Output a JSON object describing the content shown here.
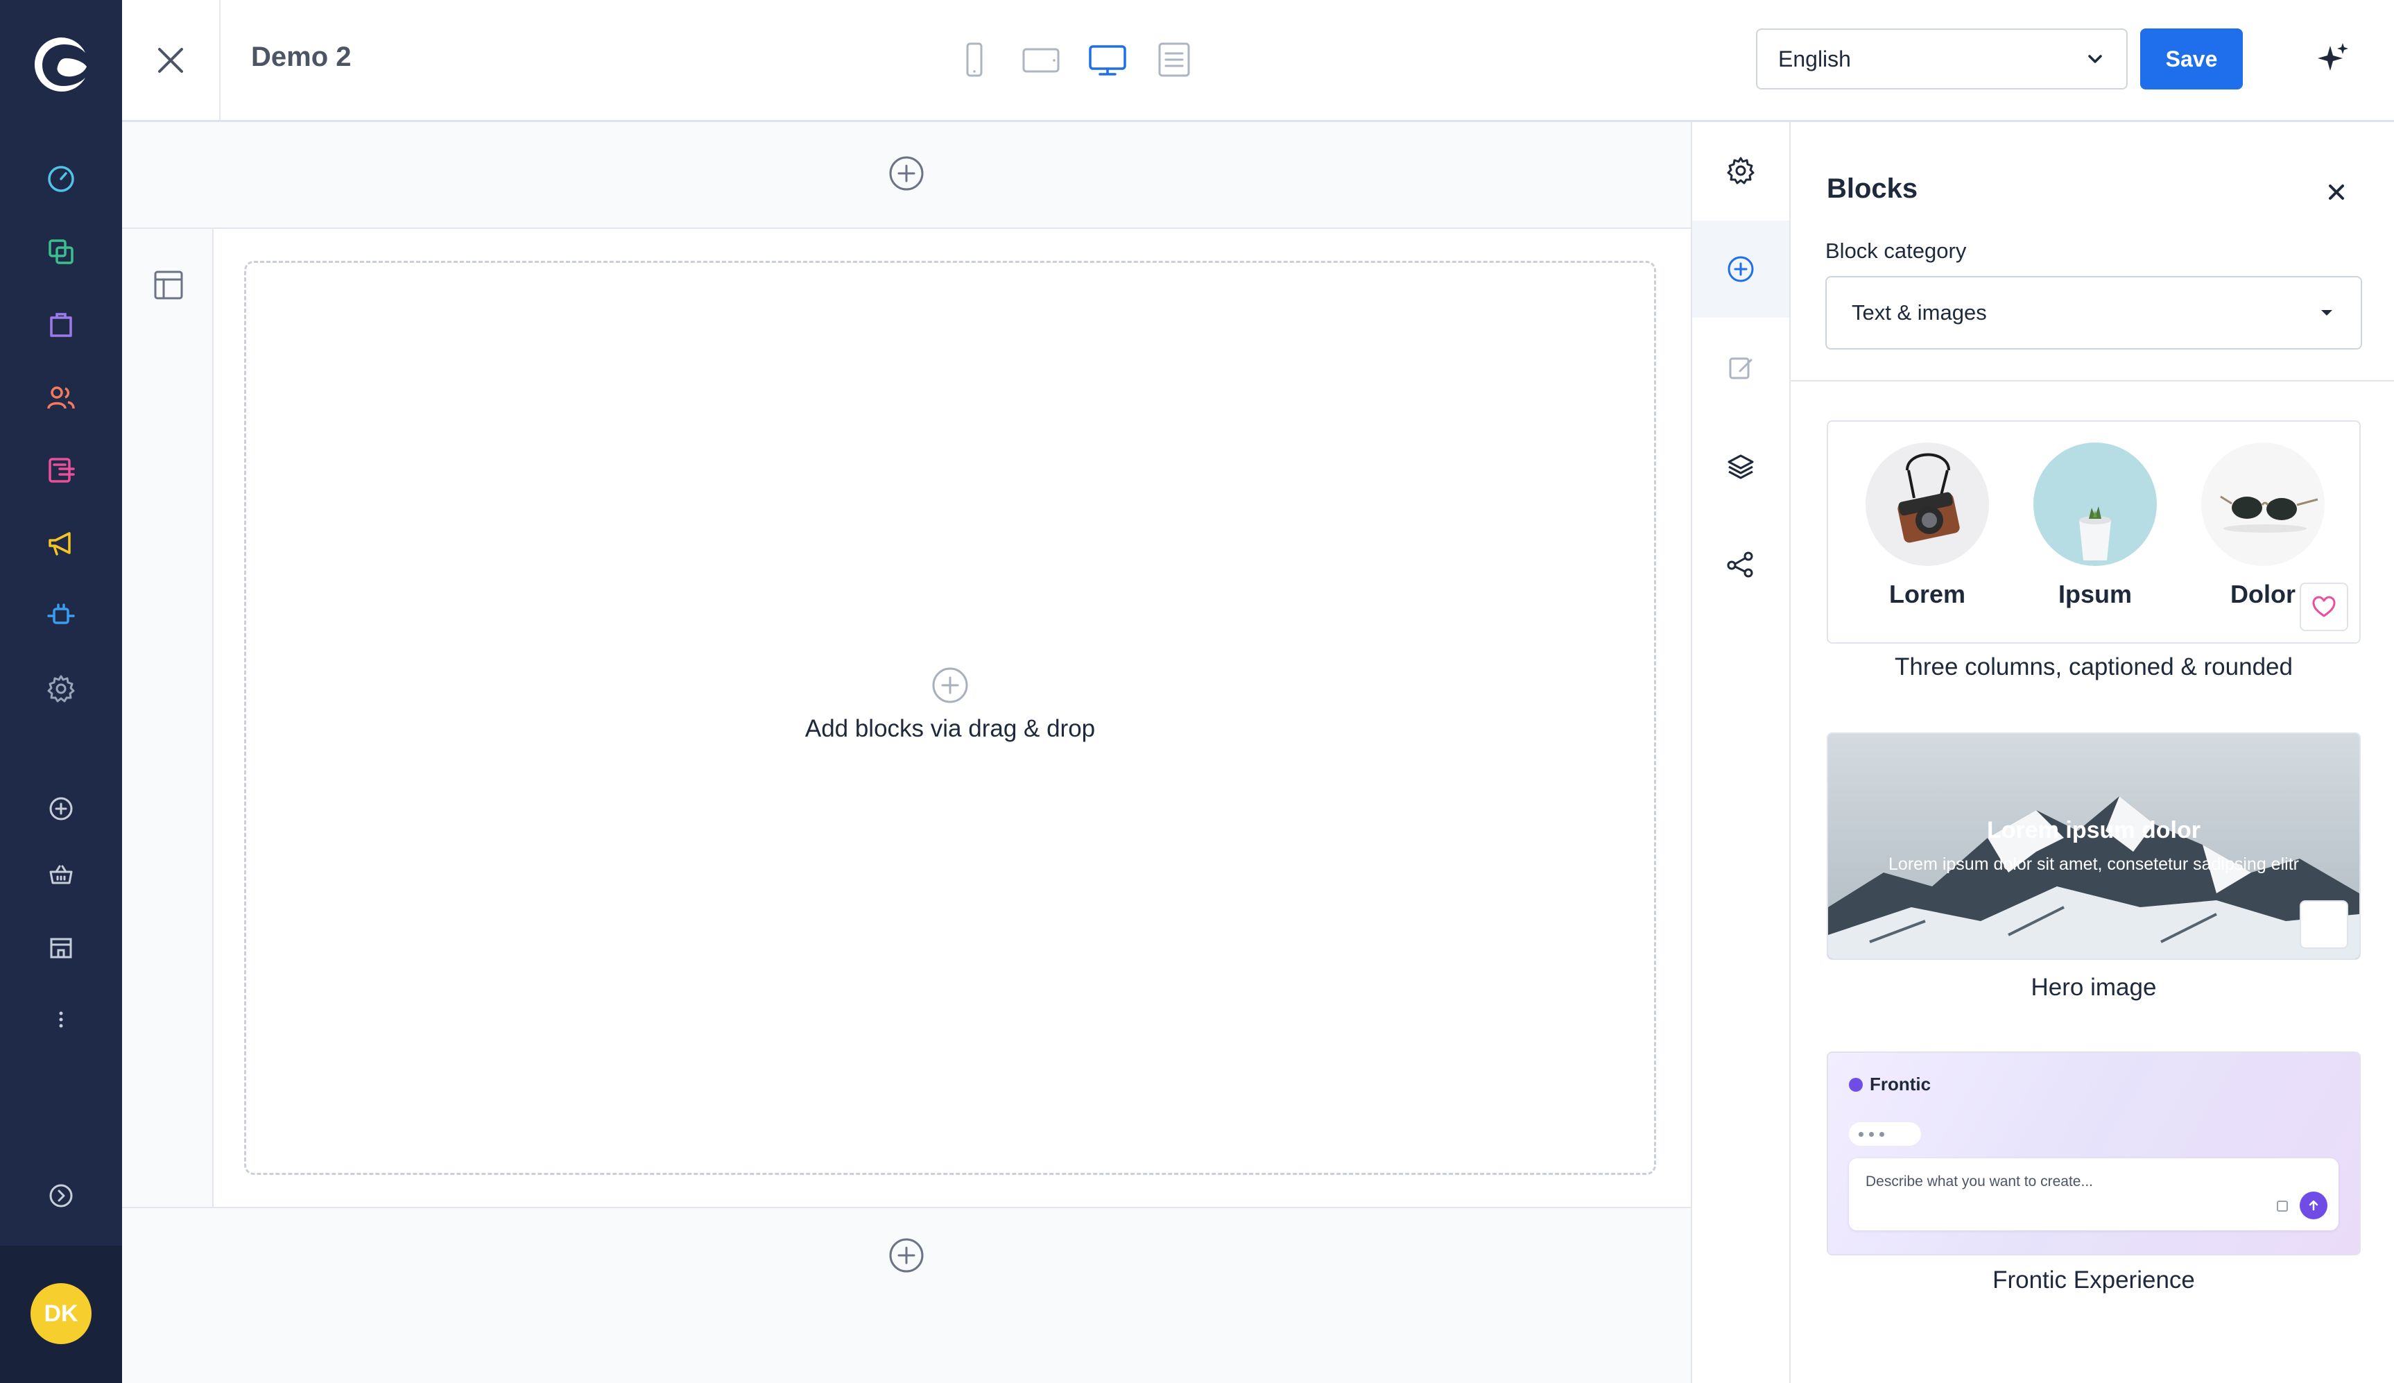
{
  "app": {
    "page_title": "Demo 2",
    "avatar_initials": "DK",
    "accent_color": "#1f6fed"
  },
  "toolbar": {
    "language": "English",
    "save_label": "Save",
    "viewports": [
      "mobile-icon",
      "tablet-icon",
      "desktop-icon",
      "form-icon"
    ],
    "active_viewport": "desktop"
  },
  "nav": {
    "items": [
      "dashboard-icon",
      "catalogues-icon",
      "orders-icon",
      "customers-icon",
      "content-icon",
      "marketing-icon",
      "extensions-icon",
      "settings-icon",
      "add-icon",
      "sales-channel-icon",
      "storefront-icon",
      "more-icon",
      "expand-icon"
    ]
  },
  "canvas": {
    "dropzone_text": "Add blocks via drag & drop"
  },
  "panel": {
    "title": "Blocks",
    "category_label": "Block category",
    "category_value": "Text & images",
    "blocks": [
      {
        "caption": "Three columns, captioned & rounded",
        "columns": [
          "Lorem",
          "Ipsum",
          "Dolor"
        ]
      },
      {
        "caption": "Hero image",
        "hero_title": "Lorem ipsum dolor",
        "hero_subtitle": "Lorem ipsum dolor sit amet, consetetur sadipsing elitr"
      },
      {
        "caption": "Frontic Experience",
        "brand": "Frontic",
        "placeholder": "Describe what you want to create..."
      }
    ]
  }
}
